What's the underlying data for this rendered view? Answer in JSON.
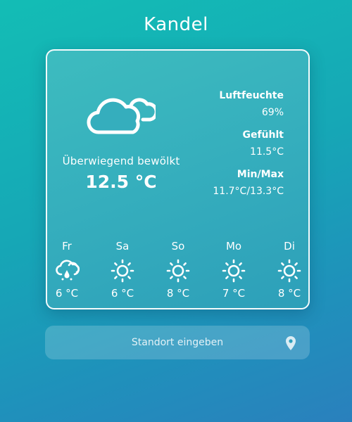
{
  "location": {
    "city": "Kandel"
  },
  "current": {
    "icon": "cloud-icon",
    "condition": "Überwiegend bewölkt",
    "temperature": "12.5 °C"
  },
  "details": {
    "humidity_label": "Luftfeuchte",
    "humidity_value": "69%",
    "feels_label": "Gefühlt",
    "feels_value": "11.5°C",
    "minmax_label": "Min/Max",
    "minmax_value": "11.7°C/13.3°C"
  },
  "forecast": [
    {
      "day": "Fr",
      "icon": "rain-cloud-icon",
      "temp": "6 °C"
    },
    {
      "day": "Sa",
      "icon": "sun-icon",
      "temp": "6 °C"
    },
    {
      "day": "So",
      "icon": "sun-icon",
      "temp": "8 °C"
    },
    {
      "day": "Mo",
      "icon": "sun-icon",
      "temp": "7 °C"
    },
    {
      "day": "Di",
      "icon": "sun-icon",
      "temp": "8 °C"
    }
  ],
  "search": {
    "placeholder": "Standort eingeben",
    "icon": "location-pin-icon"
  },
  "colors": {
    "background_start": "#13bdb5",
    "background_end": "#2a80bd",
    "text": "#ffffff"
  }
}
